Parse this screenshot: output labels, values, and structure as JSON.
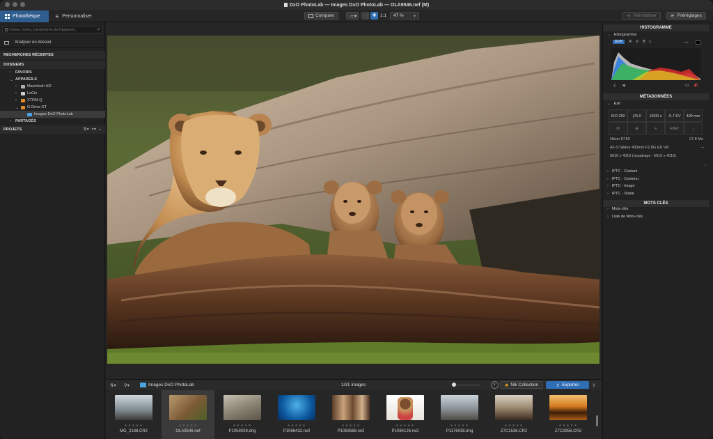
{
  "window": {
    "title": "DxO PhotoLab — Images DxO PhotoLab — OLA9546.nef (M)"
  },
  "toolbar": {
    "tabs": [
      {
        "label": "Photothèque",
        "active": true
      },
      {
        "label": "Personnaliser",
        "active": false
      }
    ],
    "compare_label": "Compare",
    "zoom_1to1": "1:1",
    "zoom_value": "47 %",
    "reset_label": "Réinitialiser",
    "presets_label": "Préréglages"
  },
  "left": {
    "search_placeholder": "Dates, notes, paramètres de l'appareil...",
    "analyze_label": "Analyser un dossier",
    "recent_searches": "RECHERCHES RÉCENTES",
    "folders": "DOSSIERS",
    "favorites": "FAVORIS",
    "devices": "APPAREILS",
    "drives": [
      {
        "label": "Macintosh HD",
        "color": "#b0b0b0"
      },
      {
        "label": "LaCie",
        "color": "#d0d0d0"
      },
      {
        "label": "XTRM-Q",
        "color": "#e08a2a"
      },
      {
        "label": "G-Drive GT",
        "color": "#e08a2a"
      }
    ],
    "selected_folder": "Images DxO PhotoLab",
    "shared": "PARTAGÉS",
    "projects": "PROJETS"
  },
  "filmstrip": {
    "folder": "Images DxO PhotoLab",
    "count": "1/31 images",
    "nik_label": "Nik Collection",
    "export_label": "Exporter",
    "thumbs": [
      {
        "name": "MG_2188.CR2"
      },
      {
        "name": "OLA9546.nef"
      },
      {
        "name": "P1058039.dng"
      },
      {
        "name": "P1066432.rw2"
      },
      {
        "name": "P1083668.rw2"
      },
      {
        "name": "P1084126.rw2"
      },
      {
        "name": "P1176038.dng"
      },
      {
        "name": "Z7C1536.CR2"
      },
      {
        "name": "Z7C2856.CR2"
      }
    ],
    "stars": "★★★★★"
  },
  "right": {
    "histogram_header": "HISTOGRAMME",
    "histogram_label": "Histogramme",
    "hist_channels": [
      "RVB",
      "R",
      "V",
      "B",
      "L"
    ],
    "metadata_header": "MÉTADONNÉES",
    "exif_label": "Exif",
    "exif_values": [
      "ISO 250",
      "ƒ/5.0",
      "1/500 s",
      "-0.7 EV",
      "400 mm"
    ],
    "exif_icons": [
      "M",
      "",
      "",
      "RAW",
      ""
    ],
    "camera": "Nikon D750",
    "filesize": "27.8 Mo",
    "lens": "AF-S Nikkor 400mm F2.8G ED VR",
    "lens_dash": "---",
    "dimensions": "6016 x 4016 (recadrage : 6015 x 4016)",
    "iptc": [
      "IPTC - Contact",
      "IPTC - Contenu",
      "IPTC - Image",
      "IPTC - Statut"
    ],
    "keywords_header": "MOTS CLÉS",
    "keywords": [
      "Mots-clés",
      "Liste de Mots-clés"
    ]
  }
}
